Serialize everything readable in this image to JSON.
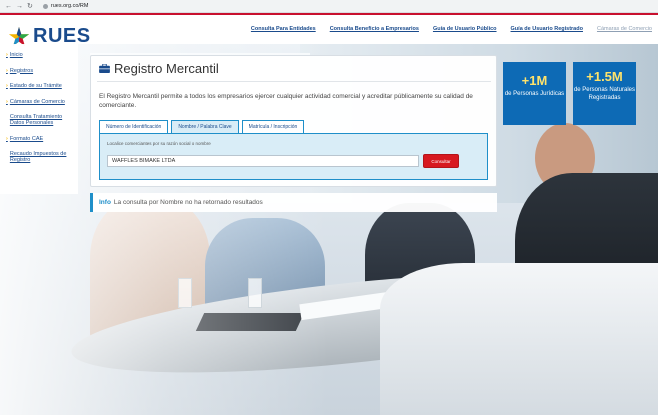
{
  "browser": {
    "url": "rues.org.co/RM"
  },
  "colors": {
    "brand_blue": "#1a4b8c",
    "accent_red": "#c8102e",
    "button_red": "#d71920",
    "stat_blue": "#0d6ab5",
    "stat_yellow": "#ffe36b",
    "tab_border": "#1f8fc9",
    "panel_bg": "#d9edf7"
  },
  "header": {
    "logo_text": "RUES",
    "nav": [
      {
        "label": "Consulta Para Entidades"
      },
      {
        "label": "Consulta Beneficio a Empresarios"
      },
      {
        "label": "Guía de Usuario Público"
      },
      {
        "label": "Guía de Usuario Registrado"
      },
      {
        "label": "Cámaras de Comercio"
      }
    ]
  },
  "sidebar": {
    "items": [
      {
        "label": "Inicio"
      },
      {
        "label": "Registros"
      },
      {
        "label": "Estado de su Trámite"
      },
      {
        "label": "Cámaras de Comercio"
      },
      {
        "label": "Consulta Tratamiento Datos Personales"
      },
      {
        "label": "Formato CAE"
      },
      {
        "label": "Recaudo Impuestos de Registro"
      }
    ]
  },
  "card": {
    "title": "Registro Mercantil",
    "description": "El Registro Mercantil permite a todos los empresarios ejercer cualquier actividad comercial y acreditar públicamente su calidad de comerciante.",
    "tabs": [
      {
        "label": "Número de Identificación",
        "active": false
      },
      {
        "label": "Nombre / Palabra Clave",
        "active": true
      },
      {
        "label": "Matrícula / Inscripción",
        "active": false
      }
    ],
    "search": {
      "label": "Localice comerciantes por su razón social o nombre",
      "value": "WAFFLES BIMAKE LTDA",
      "button_label": "Consultar"
    }
  },
  "stats": [
    {
      "big": "+1M",
      "small": "de Personas Jurídicas"
    },
    {
      "big": "+1.5M",
      "small": "de Personas Naturales Registradas"
    }
  ],
  "info": {
    "tag": "Info",
    "message": "La consulta por Nombre no ha retornado resultados"
  }
}
